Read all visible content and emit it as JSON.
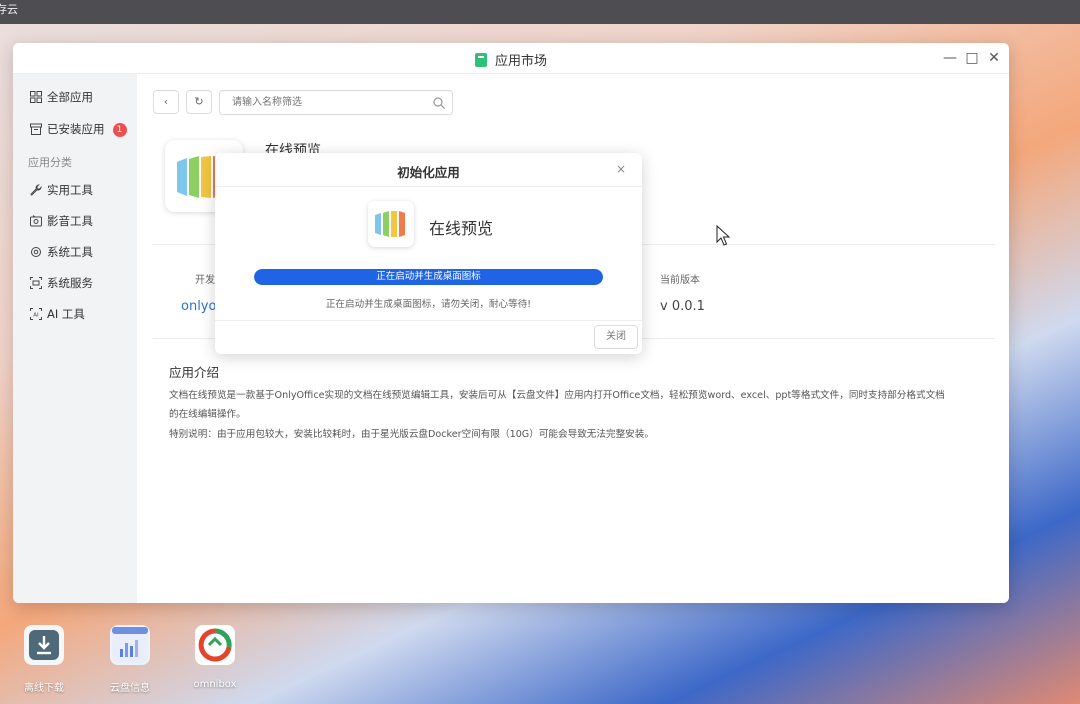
{
  "desktop": {
    "topbar_text": "存云",
    "icons": [
      {
        "label": "离线下载",
        "icon": "download-icon"
      },
      {
        "label": "云盘信息",
        "icon": "chart-icon"
      },
      {
        "label": "omnibox",
        "icon": "omnibox-logo"
      }
    ]
  },
  "window": {
    "title": "应用市场",
    "controls": {
      "minimize": "—",
      "maximize": "□",
      "close": "✕"
    }
  },
  "sidebar": {
    "items": [
      {
        "label": "全部应用",
        "icon": "grid-icon"
      },
      {
        "label": "已安装应用",
        "icon": "archive-icon",
        "badge": "1"
      }
    ],
    "category_label": "应用分类",
    "categories": [
      {
        "label": "实用工具",
        "icon": "wrench-icon"
      },
      {
        "label": "影音工具",
        "icon": "media-icon"
      },
      {
        "label": "系统工具",
        "icon": "system-icon"
      },
      {
        "label": "系统服务",
        "icon": "service-icon"
      },
      {
        "label": "AI 工具",
        "icon": "ai-icon"
      }
    ]
  },
  "toolbar": {
    "back": "‹",
    "refresh": "↻",
    "search_placeholder": "请输入名称筛选"
  },
  "app": {
    "title": "在线预览",
    "developer_label": "开发",
    "developer_value": "onlyo",
    "version_label": "当前版本",
    "version_value": "v 0.0.1",
    "intro_heading": "应用介绍",
    "intro_lines": [
      "文档在线预览是一款基于OnlyOffice实现的文档在线预览编辑工具，安装后可从【云盘文件】应用内打开Office文档，轻松预览word、excel、ppt等格式文件，同时支持部分格式文档",
      "的在线编辑操作。",
      "特别说明：由于应用包较大，安装比较耗时，由于星光版云盘Docker空间有限（10G）可能会导致无法完整安装。"
    ]
  },
  "modal": {
    "title": "初始化应用",
    "close_glyph": "×",
    "app_name": "在线预览",
    "progress_label": "正在启动并生成桌面图标",
    "progress": 1.0,
    "message": "正在启动并生成桌面图标，请勿关闭，耐心等待!",
    "close_button": "关闭"
  },
  "colors": {
    "accent": "#2064e6",
    "badge": "#f04e4e",
    "link": "#2f6fd8"
  }
}
